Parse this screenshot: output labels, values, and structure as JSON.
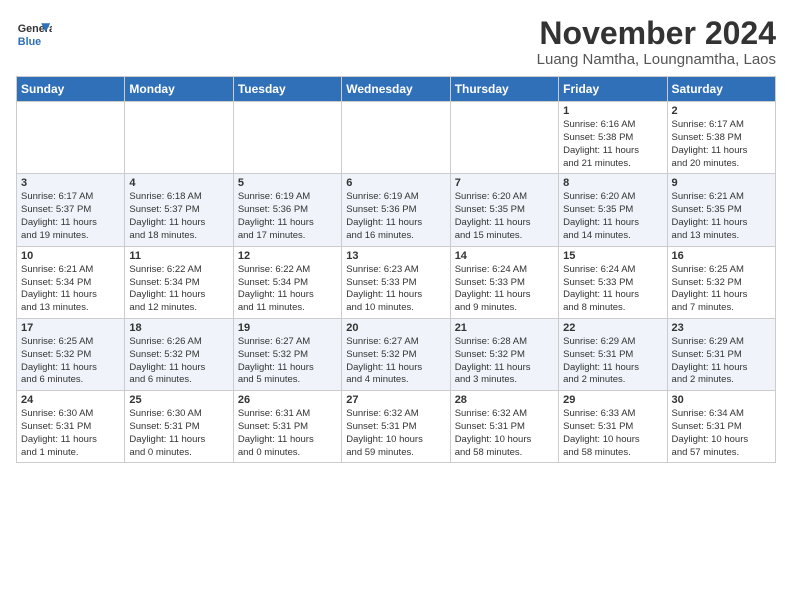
{
  "header": {
    "logo_line1": "General",
    "logo_line2": "Blue",
    "month": "November 2024",
    "location": "Luang Namtha, Loungnamtha, Laos"
  },
  "weekdays": [
    "Sunday",
    "Monday",
    "Tuesday",
    "Wednesday",
    "Thursday",
    "Friday",
    "Saturday"
  ],
  "weeks": [
    [
      {
        "day": "",
        "info": ""
      },
      {
        "day": "",
        "info": ""
      },
      {
        "day": "",
        "info": ""
      },
      {
        "day": "",
        "info": ""
      },
      {
        "day": "",
        "info": ""
      },
      {
        "day": "1",
        "info": "Sunrise: 6:16 AM\nSunset: 5:38 PM\nDaylight: 11 hours\nand 21 minutes."
      },
      {
        "day": "2",
        "info": "Sunrise: 6:17 AM\nSunset: 5:38 PM\nDaylight: 11 hours\nand 20 minutes."
      }
    ],
    [
      {
        "day": "3",
        "info": "Sunrise: 6:17 AM\nSunset: 5:37 PM\nDaylight: 11 hours\nand 19 minutes."
      },
      {
        "day": "4",
        "info": "Sunrise: 6:18 AM\nSunset: 5:37 PM\nDaylight: 11 hours\nand 18 minutes."
      },
      {
        "day": "5",
        "info": "Sunrise: 6:19 AM\nSunset: 5:36 PM\nDaylight: 11 hours\nand 17 minutes."
      },
      {
        "day": "6",
        "info": "Sunrise: 6:19 AM\nSunset: 5:36 PM\nDaylight: 11 hours\nand 16 minutes."
      },
      {
        "day": "7",
        "info": "Sunrise: 6:20 AM\nSunset: 5:35 PM\nDaylight: 11 hours\nand 15 minutes."
      },
      {
        "day": "8",
        "info": "Sunrise: 6:20 AM\nSunset: 5:35 PM\nDaylight: 11 hours\nand 14 minutes."
      },
      {
        "day": "9",
        "info": "Sunrise: 6:21 AM\nSunset: 5:35 PM\nDaylight: 11 hours\nand 13 minutes."
      }
    ],
    [
      {
        "day": "10",
        "info": "Sunrise: 6:21 AM\nSunset: 5:34 PM\nDaylight: 11 hours\nand 13 minutes."
      },
      {
        "day": "11",
        "info": "Sunrise: 6:22 AM\nSunset: 5:34 PM\nDaylight: 11 hours\nand 12 minutes."
      },
      {
        "day": "12",
        "info": "Sunrise: 6:22 AM\nSunset: 5:34 PM\nDaylight: 11 hours\nand 11 minutes."
      },
      {
        "day": "13",
        "info": "Sunrise: 6:23 AM\nSunset: 5:33 PM\nDaylight: 11 hours\nand 10 minutes."
      },
      {
        "day": "14",
        "info": "Sunrise: 6:24 AM\nSunset: 5:33 PM\nDaylight: 11 hours\nand 9 minutes."
      },
      {
        "day": "15",
        "info": "Sunrise: 6:24 AM\nSunset: 5:33 PM\nDaylight: 11 hours\nand 8 minutes."
      },
      {
        "day": "16",
        "info": "Sunrise: 6:25 AM\nSunset: 5:32 PM\nDaylight: 11 hours\nand 7 minutes."
      }
    ],
    [
      {
        "day": "17",
        "info": "Sunrise: 6:25 AM\nSunset: 5:32 PM\nDaylight: 11 hours\nand 6 minutes."
      },
      {
        "day": "18",
        "info": "Sunrise: 6:26 AM\nSunset: 5:32 PM\nDaylight: 11 hours\nand 6 minutes."
      },
      {
        "day": "19",
        "info": "Sunrise: 6:27 AM\nSunset: 5:32 PM\nDaylight: 11 hours\nand 5 minutes."
      },
      {
        "day": "20",
        "info": "Sunrise: 6:27 AM\nSunset: 5:32 PM\nDaylight: 11 hours\nand 4 minutes."
      },
      {
        "day": "21",
        "info": "Sunrise: 6:28 AM\nSunset: 5:32 PM\nDaylight: 11 hours\nand 3 minutes."
      },
      {
        "day": "22",
        "info": "Sunrise: 6:29 AM\nSunset: 5:31 PM\nDaylight: 11 hours\nand 2 minutes."
      },
      {
        "day": "23",
        "info": "Sunrise: 6:29 AM\nSunset: 5:31 PM\nDaylight: 11 hours\nand 2 minutes."
      }
    ],
    [
      {
        "day": "24",
        "info": "Sunrise: 6:30 AM\nSunset: 5:31 PM\nDaylight: 11 hours\nand 1 minute."
      },
      {
        "day": "25",
        "info": "Sunrise: 6:30 AM\nSunset: 5:31 PM\nDaylight: 11 hours\nand 0 minutes."
      },
      {
        "day": "26",
        "info": "Sunrise: 6:31 AM\nSunset: 5:31 PM\nDaylight: 11 hours\nand 0 minutes."
      },
      {
        "day": "27",
        "info": "Sunrise: 6:32 AM\nSunset: 5:31 PM\nDaylight: 10 hours\nand 59 minutes."
      },
      {
        "day": "28",
        "info": "Sunrise: 6:32 AM\nSunset: 5:31 PM\nDaylight: 10 hours\nand 58 minutes."
      },
      {
        "day": "29",
        "info": "Sunrise: 6:33 AM\nSunset: 5:31 PM\nDaylight: 10 hours\nand 58 minutes."
      },
      {
        "day": "30",
        "info": "Sunrise: 6:34 AM\nSunset: 5:31 PM\nDaylight: 10 hours\nand 57 minutes."
      }
    ]
  ]
}
